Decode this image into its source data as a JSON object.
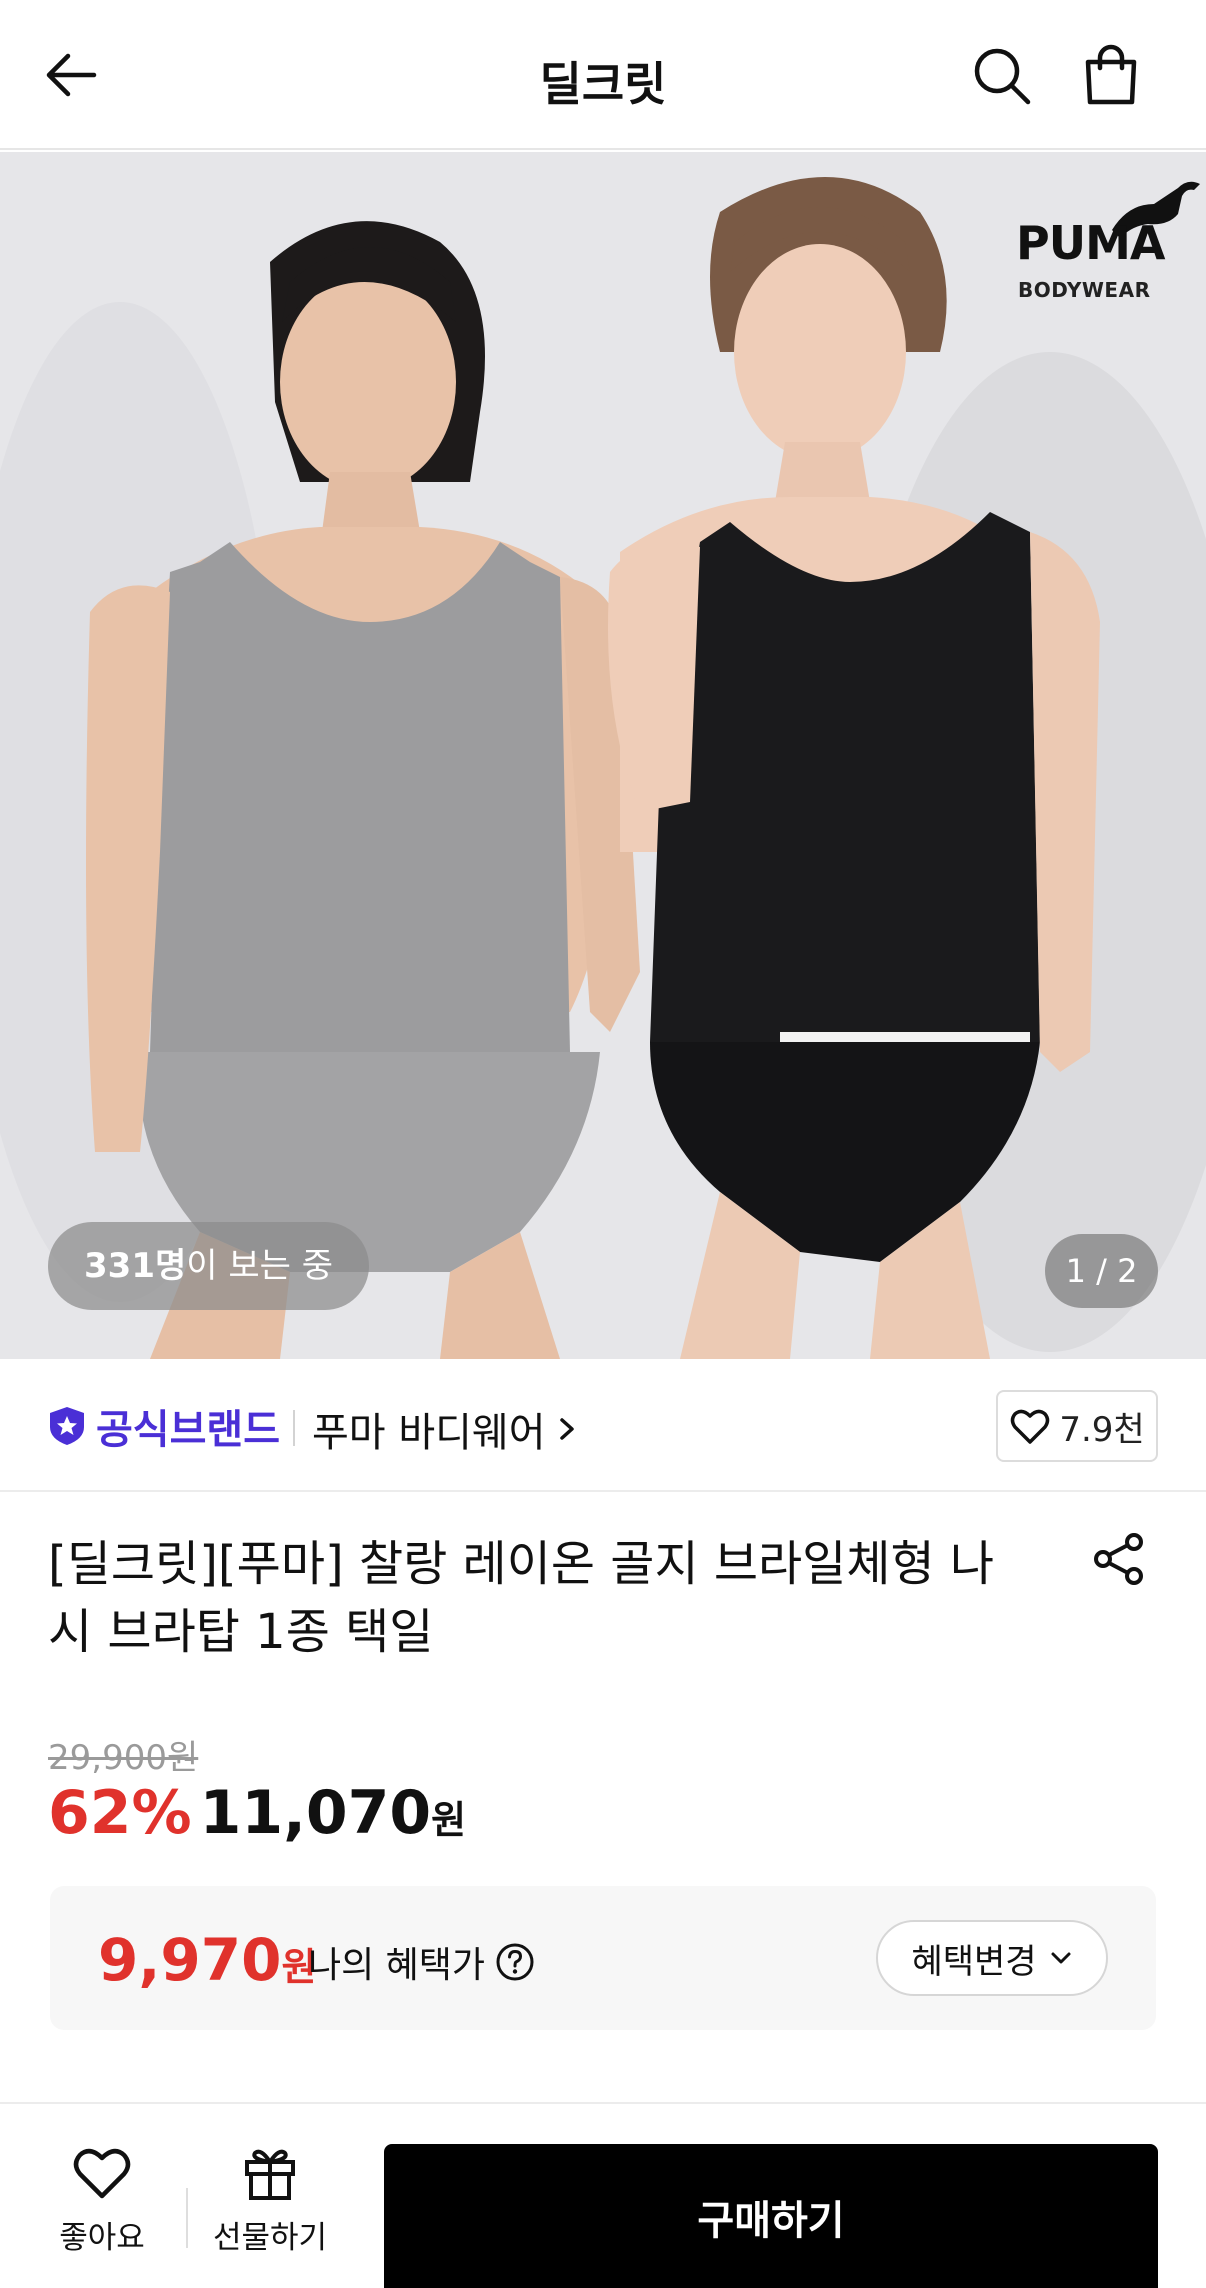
{
  "header": {
    "title": "딜크릿",
    "back_icon": "arrow-left-icon",
    "search_icon": "search-icon",
    "cart_icon": "shopping-bag-icon"
  },
  "hero": {
    "brand_logo_word": "PUMA",
    "brand_logo_sub": "BODYWEAR",
    "viewers_count": "331명",
    "viewers_suffix": "이 보는 중",
    "pager": "1 / 2"
  },
  "brand_row": {
    "official_label": "공식브랜드",
    "brand_name": "푸마 바디웨어",
    "like_count": "7.9천"
  },
  "product": {
    "title": "[딜크릿][푸마] 찰랑 레이온 골지 브라일체형 나시 브라탑 1종 택일",
    "original_price": "29,900원",
    "discount": "62%",
    "price": "11,070",
    "won": "원"
  },
  "benefit": {
    "price": "9,970",
    "won": "원",
    "label": "나의 혜택가",
    "change_button": "혜택변경"
  },
  "bottom_bar": {
    "like_label": "좋아요",
    "gift_label": "선물하기",
    "buy_label": "구매하기"
  },
  "colors": {
    "discount_red": "#e0322c",
    "official_purple": "#4a2fd6",
    "buy_button": "#000000"
  }
}
